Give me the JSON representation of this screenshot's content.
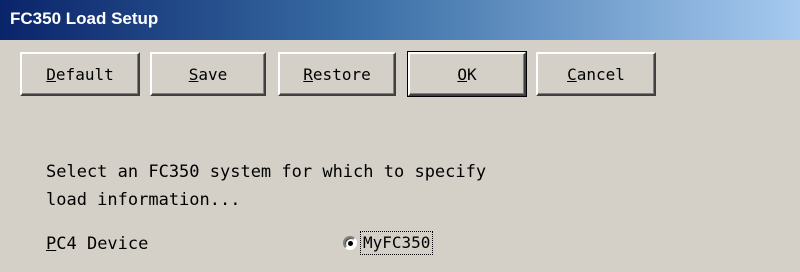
{
  "window": {
    "title": "FC350 Load Setup"
  },
  "toolbar": {
    "buttons": [
      {
        "pre": "",
        "mn": "D",
        "post": "efault"
      },
      {
        "pre": "",
        "mn": "S",
        "post": "ave"
      },
      {
        "pre": "",
        "mn": "R",
        "post": "estore"
      },
      {
        "pre": "",
        "mn": "O",
        "post": "K"
      },
      {
        "pre": "",
        "mn": "C",
        "post": "ancel"
      }
    ]
  },
  "content": {
    "instruction_line1": "Select an FC350 system for which to specify",
    "instruction_line2": "load information...",
    "device_label_mn": "P",
    "device_label_rest": "C4 Device",
    "radio_option": "MyFC350",
    "radio_selected": true
  }
}
